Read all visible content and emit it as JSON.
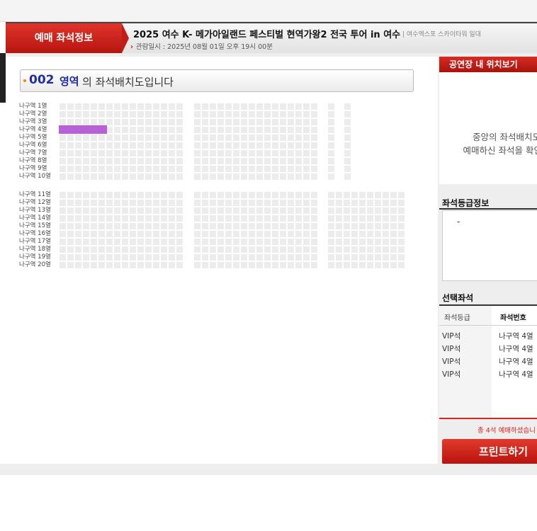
{
  "header": {
    "tab_label": "예매 좌석정보",
    "event_title": "2025 여수 K- 메가아일랜드 페스티벌 현역가왕2 전국 투어 in 여수",
    "venue": "| 여수엑스포 스카이타워 일대",
    "datetime_arrow": "›",
    "datetime": "관람일시 : 2025년 08월 01일 오후 19시 00분"
  },
  "section": {
    "code": "002",
    "name": "영역",
    "suffix": "의 좌석배치도입니다"
  },
  "seat_map": {
    "rows": [
      "나구역 1열",
      "나구역 2열",
      "나구역 3열",
      "나구역 4열",
      "나구역 5열",
      "나구역 6열",
      "나구역 7열",
      "나구역 8열",
      "나구역 9열",
      "나구역 10열",
      "나구역 11열",
      "나구역 12열",
      "나구역 13열",
      "나구역 14열",
      "나구역 15열",
      "나구역 16열",
      "나구역 17열",
      "나구역 18열",
      "나구역 19열",
      "나구역 20열"
    ],
    "selected_row": "나구역 4열",
    "selected_color": "#b860d8"
  },
  "right": {
    "venue_header": "공연장 내 위치보기",
    "venue_msg_line1": "중앙의 좌석배치도",
    "venue_msg_line2": "예매하신 좌석을 확인히",
    "grade_title": "좌석등급정보",
    "grade_value": "-",
    "selected_title": "선택좌석",
    "col_grade": "좌석등급",
    "col_seat": "좌석번호",
    "selected": [
      {
        "grade": "VIP석",
        "seat": "나구역 4열"
      },
      {
        "grade": "VIP석",
        "seat": "나구역 4열"
      },
      {
        "grade": "VIP석",
        "seat": "나구역 4열"
      },
      {
        "grade": "VIP석",
        "seat": "나구역 4열"
      }
    ],
    "total": "총 4석 예매하셨습니",
    "print_label": "프린트하기"
  },
  "colors": {
    "accent_red": "#c0141b",
    "section_blue": "#1f2fa0"
  }
}
